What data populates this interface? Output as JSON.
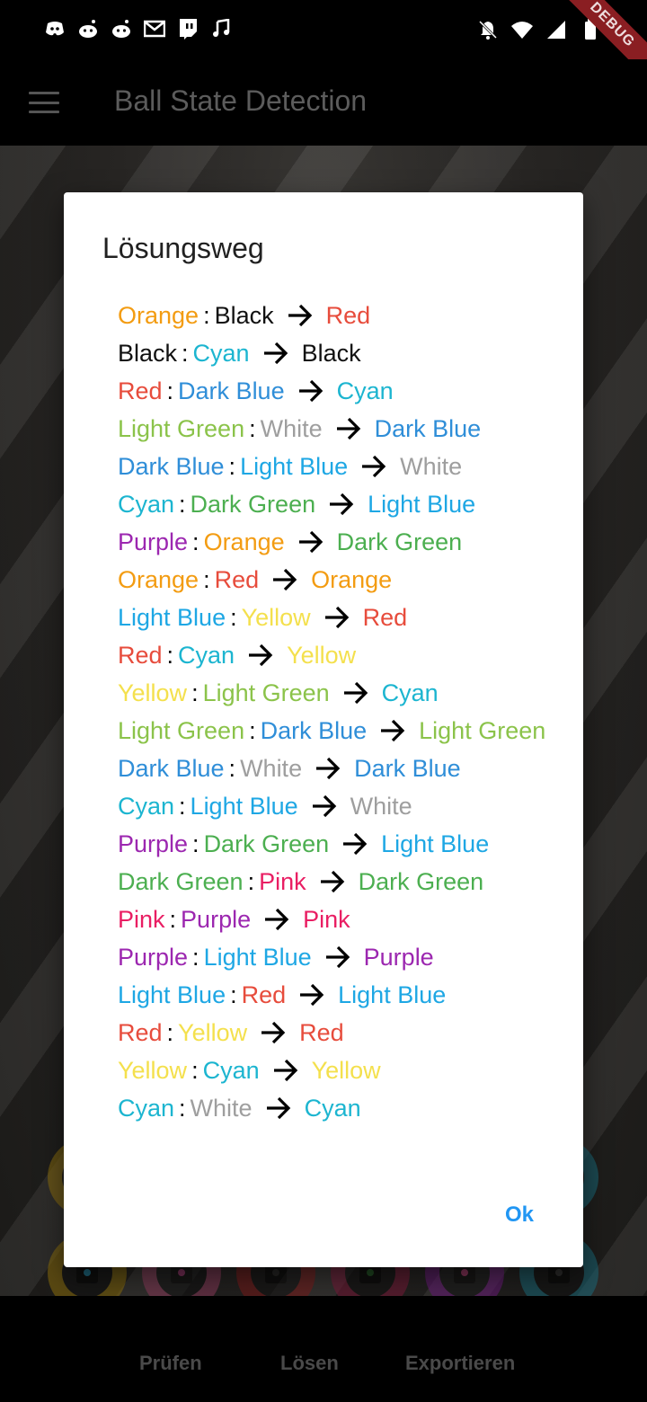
{
  "app_bar": {
    "title": "Ball State Detection"
  },
  "debug_banner": "DEBUG",
  "dialog": {
    "title": "Lösungsweg",
    "ok_label": "Ok",
    "steps": [
      {
        "from": {
          "label": "Orange",
          "color": "#f39c12"
        },
        "ball": {
          "label": "Black",
          "color": "#111111"
        },
        "to": {
          "label": "Red",
          "color": "#e74c3c"
        }
      },
      {
        "from": {
          "label": "Black",
          "color": "#111111"
        },
        "ball": {
          "label": "Cyan",
          "color": "#1cb5d0"
        },
        "to": {
          "label": "Black",
          "color": "#111111"
        }
      },
      {
        "from": {
          "label": "Red",
          "color": "#e74c3c"
        },
        "ball": {
          "label": "Dark Blue",
          "color": "#2f8ed8"
        },
        "to": {
          "label": "Cyan",
          "color": "#1cb5d0"
        }
      },
      {
        "from": {
          "label": "Light Green",
          "color": "#8bc34a"
        },
        "ball": {
          "label": "White",
          "color": "#9e9e9e"
        },
        "to": {
          "label": "Dark Blue",
          "color": "#2f8ed8"
        }
      },
      {
        "from": {
          "label": "Dark Blue",
          "color": "#2f8ed8"
        },
        "ball": {
          "label": "Light Blue",
          "color": "#1ea7e4"
        },
        "to": {
          "label": "White",
          "color": "#9e9e9e"
        }
      },
      {
        "from": {
          "label": "Cyan",
          "color": "#1cb5d0"
        },
        "ball": {
          "label": "Dark Green",
          "color": "#4caf50"
        },
        "to": {
          "label": "Light Blue",
          "color": "#1ea7e4"
        }
      },
      {
        "from": {
          "label": "Purple",
          "color": "#9c27b0"
        },
        "ball": {
          "label": "Orange",
          "color": "#f39c12"
        },
        "to": {
          "label": "Dark Green",
          "color": "#4caf50"
        }
      },
      {
        "from": {
          "label": "Orange",
          "color": "#f39c12"
        },
        "ball": {
          "label": "Red",
          "color": "#e74c3c"
        },
        "to": {
          "label": "Orange",
          "color": "#f39c12"
        }
      },
      {
        "from": {
          "label": "Light Blue",
          "color": "#1ea7e4"
        },
        "ball": {
          "label": "Yellow",
          "color": "#f4e04d"
        },
        "to": {
          "label": "Red",
          "color": "#e74c3c"
        }
      },
      {
        "from": {
          "label": "Red",
          "color": "#e74c3c"
        },
        "ball": {
          "label": "Cyan",
          "color": "#1cb5d0"
        },
        "to": {
          "label": "Yellow",
          "color": "#f4e04d"
        }
      },
      {
        "from": {
          "label": "Yellow",
          "color": "#f4e04d"
        },
        "ball": {
          "label": "Light Green",
          "color": "#8bc34a"
        },
        "to": {
          "label": "Cyan",
          "color": "#1cb5d0"
        }
      },
      {
        "from": {
          "label": "Light Green",
          "color": "#8bc34a"
        },
        "ball": {
          "label": "Dark Blue",
          "color": "#2f8ed8"
        },
        "to": {
          "label": "Light Green",
          "color": "#8bc34a"
        }
      },
      {
        "from": {
          "label": "Dark Blue",
          "color": "#2f8ed8"
        },
        "ball": {
          "label": "White",
          "color": "#9e9e9e"
        },
        "to": {
          "label": "Dark Blue",
          "color": "#2f8ed8"
        }
      },
      {
        "from": {
          "label": "Cyan",
          "color": "#1cb5d0"
        },
        "ball": {
          "label": "Light Blue",
          "color": "#1ea7e4"
        },
        "to": {
          "label": "White",
          "color": "#9e9e9e"
        }
      },
      {
        "from": {
          "label": "Purple",
          "color": "#9c27b0"
        },
        "ball": {
          "label": "Dark Green",
          "color": "#4caf50"
        },
        "to": {
          "label": "Light Blue",
          "color": "#1ea7e4"
        }
      },
      {
        "from": {
          "label": "Dark Green",
          "color": "#4caf50"
        },
        "ball": {
          "label": "Pink",
          "color": "#e91e63"
        },
        "to": {
          "label": "Dark Green",
          "color": "#4caf50"
        }
      },
      {
        "from": {
          "label": "Pink",
          "color": "#e91e63"
        },
        "ball": {
          "label": "Purple",
          "color": "#9c27b0"
        },
        "to": {
          "label": "Pink",
          "color": "#e91e63"
        }
      },
      {
        "from": {
          "label": "Purple",
          "color": "#9c27b0"
        },
        "ball": {
          "label": "Light Blue",
          "color": "#1ea7e4"
        },
        "to": {
          "label": "Purple",
          "color": "#9c27b0"
        }
      },
      {
        "from": {
          "label": "Light Blue",
          "color": "#1ea7e4"
        },
        "ball": {
          "label": "Red",
          "color": "#e74c3c"
        },
        "to": {
          "label": "Light Blue",
          "color": "#1ea7e4"
        }
      },
      {
        "from": {
          "label": "Red",
          "color": "#e74c3c"
        },
        "ball": {
          "label": "Yellow",
          "color": "#f4e04d"
        },
        "to": {
          "label": "Red",
          "color": "#e74c3c"
        }
      },
      {
        "from": {
          "label": "Yellow",
          "color": "#f4e04d"
        },
        "ball": {
          "label": "Cyan",
          "color": "#1cb5d0"
        },
        "to": {
          "label": "Yellow",
          "color": "#f4e04d"
        }
      },
      {
        "from": {
          "label": "Cyan",
          "color": "#1cb5d0"
        },
        "ball": {
          "label": "White",
          "color": "#9e9e9e"
        },
        "to": {
          "label": "Cyan",
          "color": "#1cb5d0"
        }
      }
    ]
  },
  "background_balls": [
    {
      "ring": "#8a6d0d",
      "dot": "#1a8cb0"
    },
    {
      "ring": "#8a3a5a",
      "dot": "#9c2a6a"
    },
    {
      "ring": "#7a1a1a",
      "dot": "#222222"
    },
    {
      "ring": "#7a1a3a",
      "dot": "#1b5e20"
    },
    {
      "ring": "#6a1a7a",
      "dot": "#b0306a"
    },
    {
      "ring": "#1a6a7a",
      "dot": "#333333"
    }
  ],
  "bottom_nav": {
    "check_label": "Prüfen",
    "solve_label": "Lösen",
    "export_label": "Exportieren"
  }
}
